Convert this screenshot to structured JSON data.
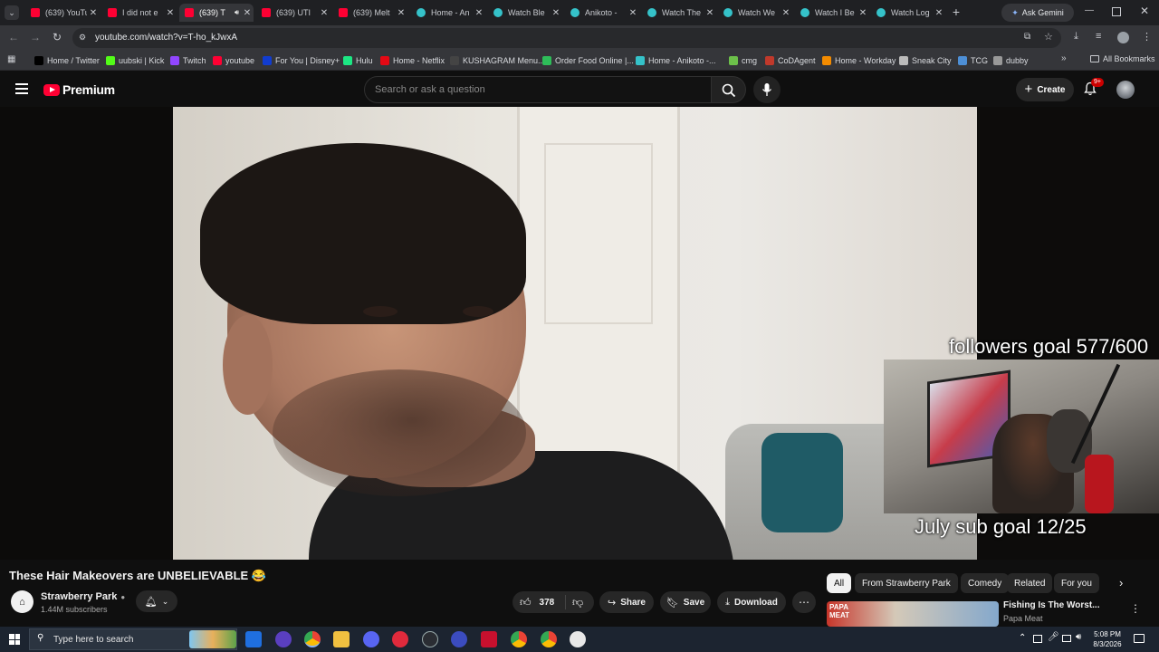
{
  "browser": {
    "tabs": [
      {
        "label": "(639) YouTube",
        "favicon": "youtube"
      },
      {
        "label": "I did not e",
        "favicon": "youtube"
      },
      {
        "label": "(639) T",
        "favicon": "youtube",
        "active": true
      },
      {
        "label": "(639) UTI",
        "favicon": "youtube"
      },
      {
        "label": "(639) Melt",
        "favicon": "youtube"
      },
      {
        "label": "Home - An",
        "favicon": "globe"
      },
      {
        "label": "Watch Ble",
        "favicon": "globe"
      },
      {
        "label": "Anikoto -",
        "favicon": "globe"
      },
      {
        "label": "Watch The",
        "favicon": "globe"
      },
      {
        "label": "Watch We",
        "favicon": "globe"
      },
      {
        "label": "Watch I Be",
        "favicon": "globe"
      },
      {
        "label": "Watch Log",
        "favicon": "globe"
      }
    ],
    "new_tab": "+",
    "ask_gemini": "Ask Gemini",
    "url": "youtube.com/watch?v=T-ho_kJwxA",
    "bookmarks": [
      {
        "label": "Home / Twitter",
        "color": "#000000"
      },
      {
        "label": "uubski | Kick",
        "color": "#53fc18"
      },
      {
        "label": "Twitch",
        "color": "#9146ff"
      },
      {
        "label": "youtube",
        "color": "#ff0033"
      },
      {
        "label": "For You | Disney+",
        "color": "#113ccf"
      },
      {
        "label": "Hulu",
        "color": "#1ce783"
      },
      {
        "label": "Home - Netflix",
        "color": "#e50914"
      },
      {
        "label": "KUSHAGRAM Menu...",
        "color": "#444444"
      },
      {
        "label": "Order Food Online |...",
        "color": "#2ebd59"
      },
      {
        "label": "Home - Anikoto -...",
        "color": "#35c2c9"
      },
      {
        "label": "cmg",
        "color": "#6cc04a"
      },
      {
        "label": "CoDAgent",
        "color": "#c0392b"
      },
      {
        "label": "Home - Workday",
        "color": "#f38b00"
      },
      {
        "label": "Sneak City",
        "color": "#bbbbbb"
      },
      {
        "label": "TCG",
        "color": "#4d8fd6"
      },
      {
        "label": "dubby",
        "color": "#999999"
      }
    ],
    "all_bookmarks": "All Bookmarks"
  },
  "youtube": {
    "logo": "Premium",
    "search_placeholder": "Search or ask a question",
    "create_label": "Create",
    "notif_count": "9+"
  },
  "video": {
    "overlay_top": "followers goal 577/600",
    "overlay_bottom": "July sub goal 12/25",
    "title": "These Hair Makeovers are UNBELIEVABLE 😂",
    "channel": "Strawberry Park",
    "subscribers": "1.44M subscribers",
    "likes": "378",
    "share": "Share",
    "save": "Save",
    "download": "Download"
  },
  "chips": [
    "All",
    "From Strawberry Park",
    "Comedy",
    "Related",
    "For you"
  ],
  "recommended": {
    "title": "Fishing Is The Worst...",
    "channel": "Papa Meat",
    "thumb_text": "PAPA MEAT"
  },
  "taskbar": {
    "search_placeholder": "Type here to search",
    "time": "5:08 PM",
    "date": "8/3/2026"
  }
}
